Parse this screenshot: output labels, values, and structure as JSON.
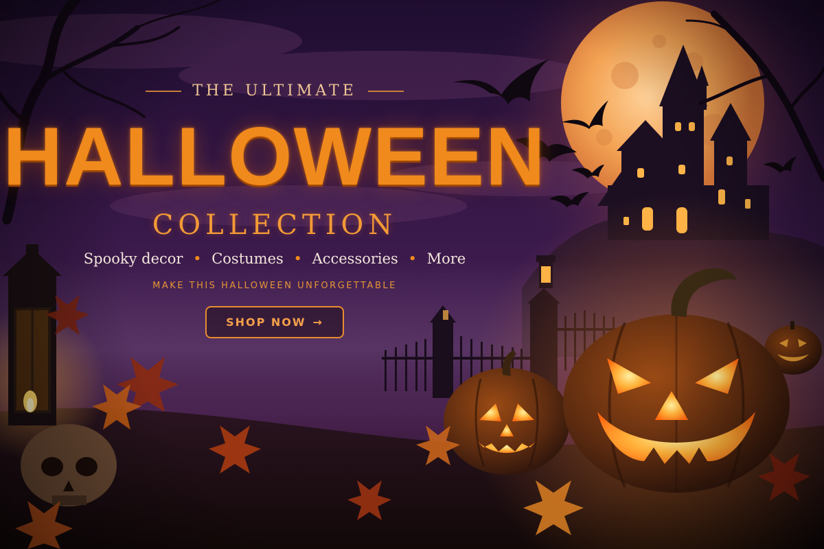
{
  "hero": {
    "eyebrow": "THE ULTIMATE",
    "headline": "HALLOWEEN",
    "sub_headline": "COLLECTION",
    "categories": [
      "Spooky decor",
      "Costumes",
      "Accessories",
      "More"
    ],
    "separator": "•",
    "tagline": "MAKE THIS HALLOWEEN UNFORGETTABLE",
    "cta_label": "SHOP NOW",
    "cta_arrow": "→"
  },
  "icons": {
    "scene": [
      "full-moon-icon",
      "haunted-house-icon",
      "bat-icon",
      "jack-o-lantern-icon",
      "lantern-icon",
      "skull-icon",
      "autumn-leaf-icon",
      "iron-fence-icon",
      "bare-tree-icon"
    ]
  },
  "colors": {
    "accent": "#f08a1c",
    "moon": "#f4a252",
    "sky_top": "#2a1240",
    "sky_bottom": "#5a2a5c",
    "text_light": "#f3e6dc"
  }
}
